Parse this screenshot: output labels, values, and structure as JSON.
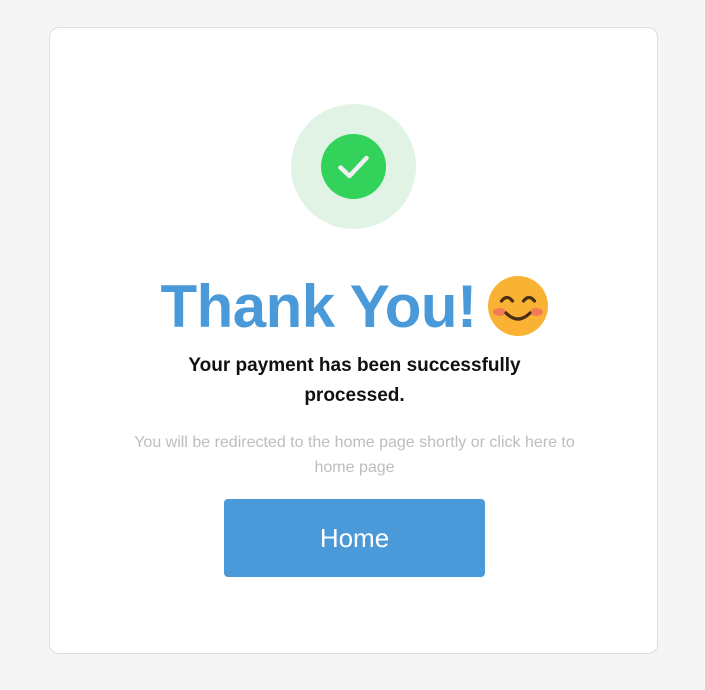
{
  "confirmation": {
    "icon": "checkmark-circle-icon",
    "title": "Thank You!",
    "title_emoji": "smiling-face-emoji",
    "message": "Your payment has been successfully processed.",
    "note": "You will be redirected to the home page shortly or click here to home page",
    "button_label": "Home"
  },
  "colors": {
    "page_background": "#f5f5f5",
    "card_background": "#ffffff",
    "accent_blue": "#4a9ad9",
    "success_green": "#33d35b",
    "success_halo": "#e0f3e4",
    "muted_text": "#bdbdbd"
  }
}
